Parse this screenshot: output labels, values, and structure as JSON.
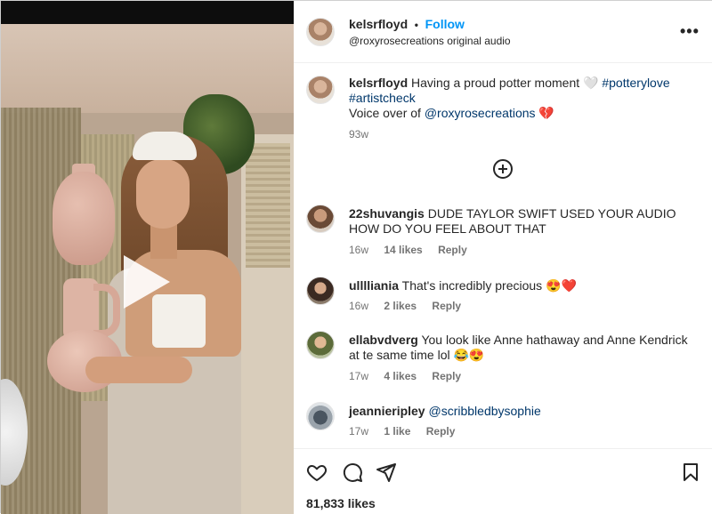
{
  "post": {
    "username": "kelsrfloyd",
    "follow_label": "Follow",
    "separator": "•",
    "audio": "@roxyrosecreations original audio",
    "more_icon": "more-horizontal-icon"
  },
  "caption": {
    "username": "kelsrfloyd",
    "text": "Having a proud potter moment 🤍",
    "hashtag1": "#potterylove",
    "hashtag2": "#artistcheck",
    "voice_prefix": "Voice over of",
    "mention": "@roxyrosecreations",
    "emoji": "💔",
    "time": "93w"
  },
  "comments": [
    {
      "username": "22shuvangis",
      "text": "DUDE TAYLOR SWIFT USED YOUR AUDIO HOW DO YOU FEEL ABOUT THAT",
      "time": "16w",
      "likes": "14 likes",
      "reply": "Reply"
    },
    {
      "username": "ulllliania",
      "text": "That's incredibly precious 😍❤️",
      "time": "16w",
      "likes": "2 likes",
      "reply": "Reply"
    },
    {
      "username": "ellabvdverg",
      "text": "You look like Anne hathaway and Anne Kendrick at te same time lol 😂😍",
      "time": "17w",
      "likes": "4 likes",
      "reply": "Reply"
    },
    {
      "username": "jeannieripley",
      "text": "@scribbledbysophie",
      "time": "17w",
      "likes": "1 like",
      "reply": "Reply"
    }
  ],
  "footer": {
    "likes": "81,833 likes",
    "icons": [
      "heart-icon",
      "comment-icon",
      "share-icon",
      "bookmark-icon"
    ]
  },
  "media": {
    "play_icon": "play-icon"
  }
}
